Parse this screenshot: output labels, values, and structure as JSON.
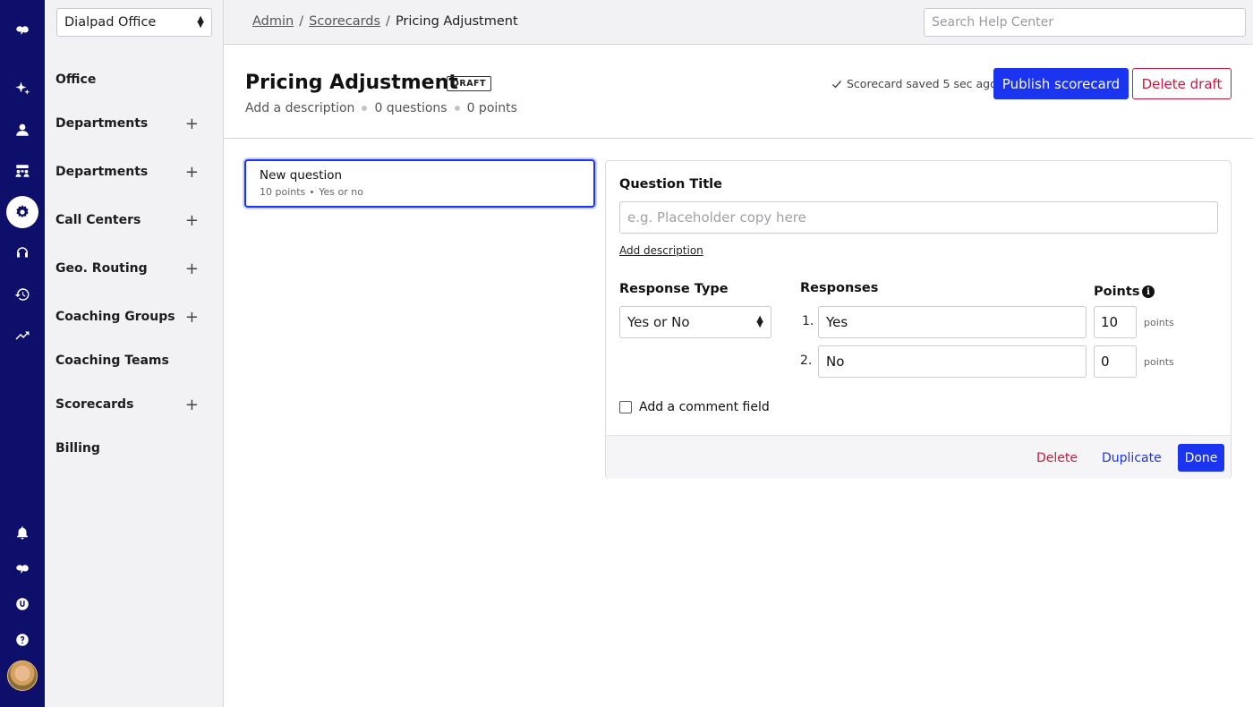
{
  "office_select": {
    "value": "Dialpad Office"
  },
  "nav": {
    "items": [
      {
        "label": "Office",
        "expandable": false
      },
      {
        "label": "Departments",
        "expandable": true
      },
      {
        "label": "Departments",
        "expandable": true
      },
      {
        "label": "Call Centers",
        "expandable": true
      },
      {
        "label": "Geo. Routing",
        "expandable": true
      },
      {
        "label": "Coaching Groups",
        "expandable": true
      },
      {
        "label": "Coaching Teams",
        "expandable": false
      },
      {
        "label": "Scorecards",
        "expandable": true
      },
      {
        "label": "Billing",
        "expandable": false
      }
    ],
    "plus": "+"
  },
  "breadcrumb": {
    "admin": "Admin",
    "scorecards": "Scorecards",
    "current": "Pricing Adjustment",
    "sep": "/"
  },
  "search": {
    "placeholder": "Search Help Center"
  },
  "header": {
    "title": "Pricing Adjustment",
    "badge": "DRAFT",
    "add_description": "Add a description",
    "questions": "0 questions",
    "points": "0 points",
    "saved": "Scorecard saved 5 sec ago",
    "publish": "Publish scorecard",
    "delete_draft": "Delete draft"
  },
  "question_card": {
    "title": "New question",
    "points": "10 points",
    "type": "Yes or no"
  },
  "editor": {
    "question_title_label": "Question Title",
    "question_title_placeholder": "e.g. Placeholder copy here",
    "add_description": "Add description",
    "response_type_label": "Response Type",
    "response_type_value": "Yes or No",
    "responses_label": "Responses",
    "points_label": "Points",
    "responses": [
      {
        "num": "1.",
        "value": "Yes",
        "points": "10",
        "unit": "points"
      },
      {
        "num": "2.",
        "value": "No",
        "points": "0",
        "unit": "points"
      }
    ],
    "comment_field_label": "Add a comment field",
    "delete": "Delete",
    "duplicate": "Duplicate",
    "done": "Done"
  },
  "colors": {
    "rail": "#0d0f6b",
    "primary": "#1a34f0",
    "danger": "#c9173d"
  },
  "icons": [
    "dialpad-logo-icon",
    "sparkle-icon",
    "person-icon",
    "contact-center-icon",
    "gear-icon",
    "headset-icon",
    "history-icon",
    "trending-icon",
    "bell-icon",
    "dialpad-icon",
    "dialpad-u-icon",
    "help-icon"
  ]
}
